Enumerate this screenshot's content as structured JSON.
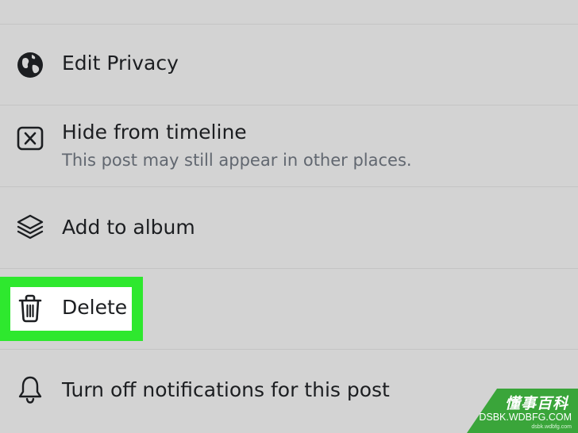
{
  "menu": {
    "items": [
      {
        "label": "Edit Privacy",
        "icon": "globe-icon"
      },
      {
        "label": "Hide from timeline",
        "sublabel": "This post may still appear in other places.",
        "icon": "close-box-icon"
      },
      {
        "label": "Add to album",
        "icon": "layers-icon"
      },
      {
        "label": "Delete",
        "icon": "trash-icon",
        "highlighted": true
      },
      {
        "label": "Turn off notifications for this post",
        "icon": "bell-icon"
      }
    ]
  },
  "colors": {
    "background": "#d3d3d3",
    "highlight": "#2ee82e",
    "text": "#1c1e21",
    "subtext": "#616770",
    "watermark": "#3aa53a"
  },
  "watermark": {
    "title": "懂事百科",
    "url": "DSBK.WDBFG.COM",
    "small": "dsbk.wdbfg.com"
  }
}
